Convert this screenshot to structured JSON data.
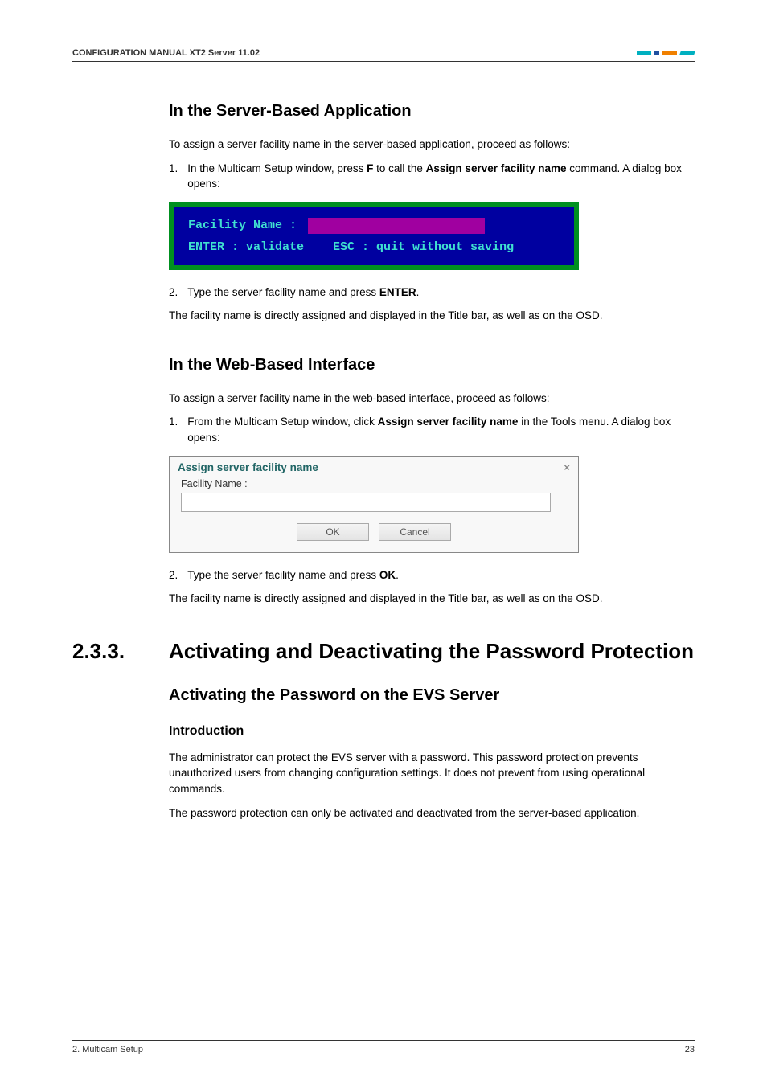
{
  "header": {
    "text": "CONFIGURATION MANUAL  XT2 Server 11.02"
  },
  "section1": {
    "heading": "In the Server-Based Application",
    "intro": "To assign a server facility name in the server-based application, proceed as follows:",
    "step1_num": "1.",
    "step1_before_f": "In the Multicam Setup window, press ",
    "step1_f": "F",
    "step1_mid": " to call the ",
    "step1_bold": "Assign server facility name",
    "step1_after": " command. A dialog box opens:",
    "dos_label": "Facility Name :",
    "dos_enter": "ENTER : validate",
    "dos_esc": "ESC : quit without saving",
    "step2_num": "2.",
    "step2_before": "Type the server facility name and press ",
    "step2_bold": "ENTER",
    "step2_after": ".",
    "outro": "The facility name is directly assigned and displayed in the Title bar, as well as on the OSD."
  },
  "section2": {
    "heading": "In the Web-Based Interface",
    "intro": "To assign a server facility name in the web-based interface, proceed as follows:",
    "step1_num": "1.",
    "step1_before": "From the Multicam Setup window, click ",
    "step1_bold": "Assign server facility name",
    "step1_after": " in the Tools menu. A dialog box opens:",
    "web_title": "Assign server facility name",
    "web_close": "×",
    "web_label": "Facility Name :",
    "web_ok": "OK",
    "web_cancel": "Cancel",
    "step2_num": "2.",
    "step2_before": "Type the server facility name and press ",
    "step2_bold": "OK",
    "step2_after": ".",
    "outro": "The facility name is directly assigned and displayed in the Title bar, as well as on the OSD."
  },
  "section3": {
    "num": "2.3.3.",
    "title": "Activating and Deactivating the Password Protection",
    "sub1": "Activating the Password on the EVS Server",
    "sub2": "Introduction",
    "p1": "The administrator can protect the EVS server with a password. This password protection prevents unauthorized users from changing configuration settings. It does not prevent from using operational commands.",
    "p2": "The password protection can only be activated and deactivated from the server-based application."
  },
  "footer": {
    "left": "2. Multicam Setup",
    "right": "23"
  }
}
